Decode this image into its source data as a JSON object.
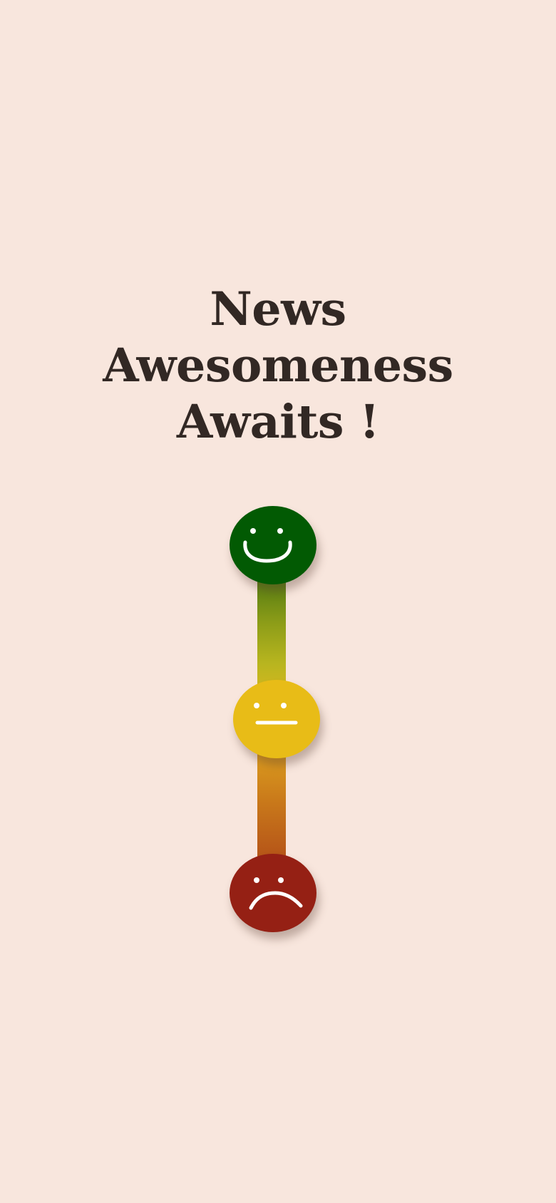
{
  "headline": {
    "line1": "News",
    "line2": "Awesomeness",
    "line3": "Awaits !"
  },
  "moods": [
    {
      "icon": "happy-face-icon",
      "color": "#025a03"
    },
    {
      "icon": "neutral-face-icon",
      "color": "#e8bc17"
    },
    {
      "icon": "sad-face-icon",
      "color": "#952014"
    }
  ],
  "colors": {
    "background": "#f8e6dd",
    "text": "#322824",
    "face_features": "#ffffff"
  }
}
